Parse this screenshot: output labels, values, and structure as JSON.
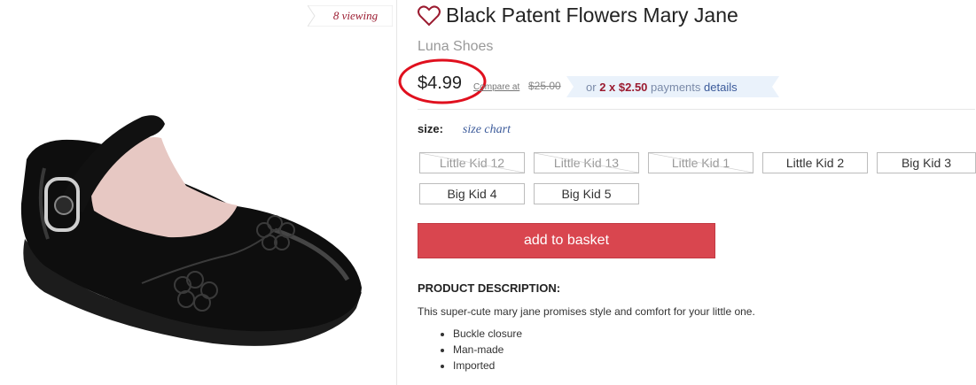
{
  "viewing": {
    "text": "8 viewing"
  },
  "product": {
    "title": "Black Patent Flowers Mary Jane",
    "brand": "Luna Shoes",
    "image_icon": "black-mary-jane-shoe",
    "favorite_icon": "heart-outline-icon"
  },
  "pricing": {
    "price": "$4.99",
    "compare_label": "Compare at",
    "compare_price": "$25.00",
    "installments": {
      "prefix": "or",
      "amount": "2 x $2.50",
      "label": "payments",
      "details": "details"
    }
  },
  "size": {
    "label": "size:",
    "chart_link": "size chart",
    "options": [
      {
        "label": "Little Kid 12",
        "available": false
      },
      {
        "label": "Little Kid 13",
        "available": false
      },
      {
        "label": "Little Kid 1",
        "available": false
      },
      {
        "label": "Little Kid 2",
        "available": true
      },
      {
        "label": "Big Kid 3",
        "available": true
      },
      {
        "label": "Big Kid 4",
        "available": true
      },
      {
        "label": "Big Kid 5",
        "available": true
      }
    ]
  },
  "cart": {
    "add_label": "add to basket"
  },
  "description": {
    "title": "PRODUCT DESCRIPTION:",
    "text": "This super-cute mary jane promises style and comfort for your little one.",
    "features": [
      "Buckle closure",
      "Man-made",
      "Imported"
    ]
  },
  "colors": {
    "accent_red": "#d9464f",
    "brand_maroon": "#9b1b30",
    "link_blue": "#3b5a9a",
    "annotation_red": "#e0101e"
  }
}
